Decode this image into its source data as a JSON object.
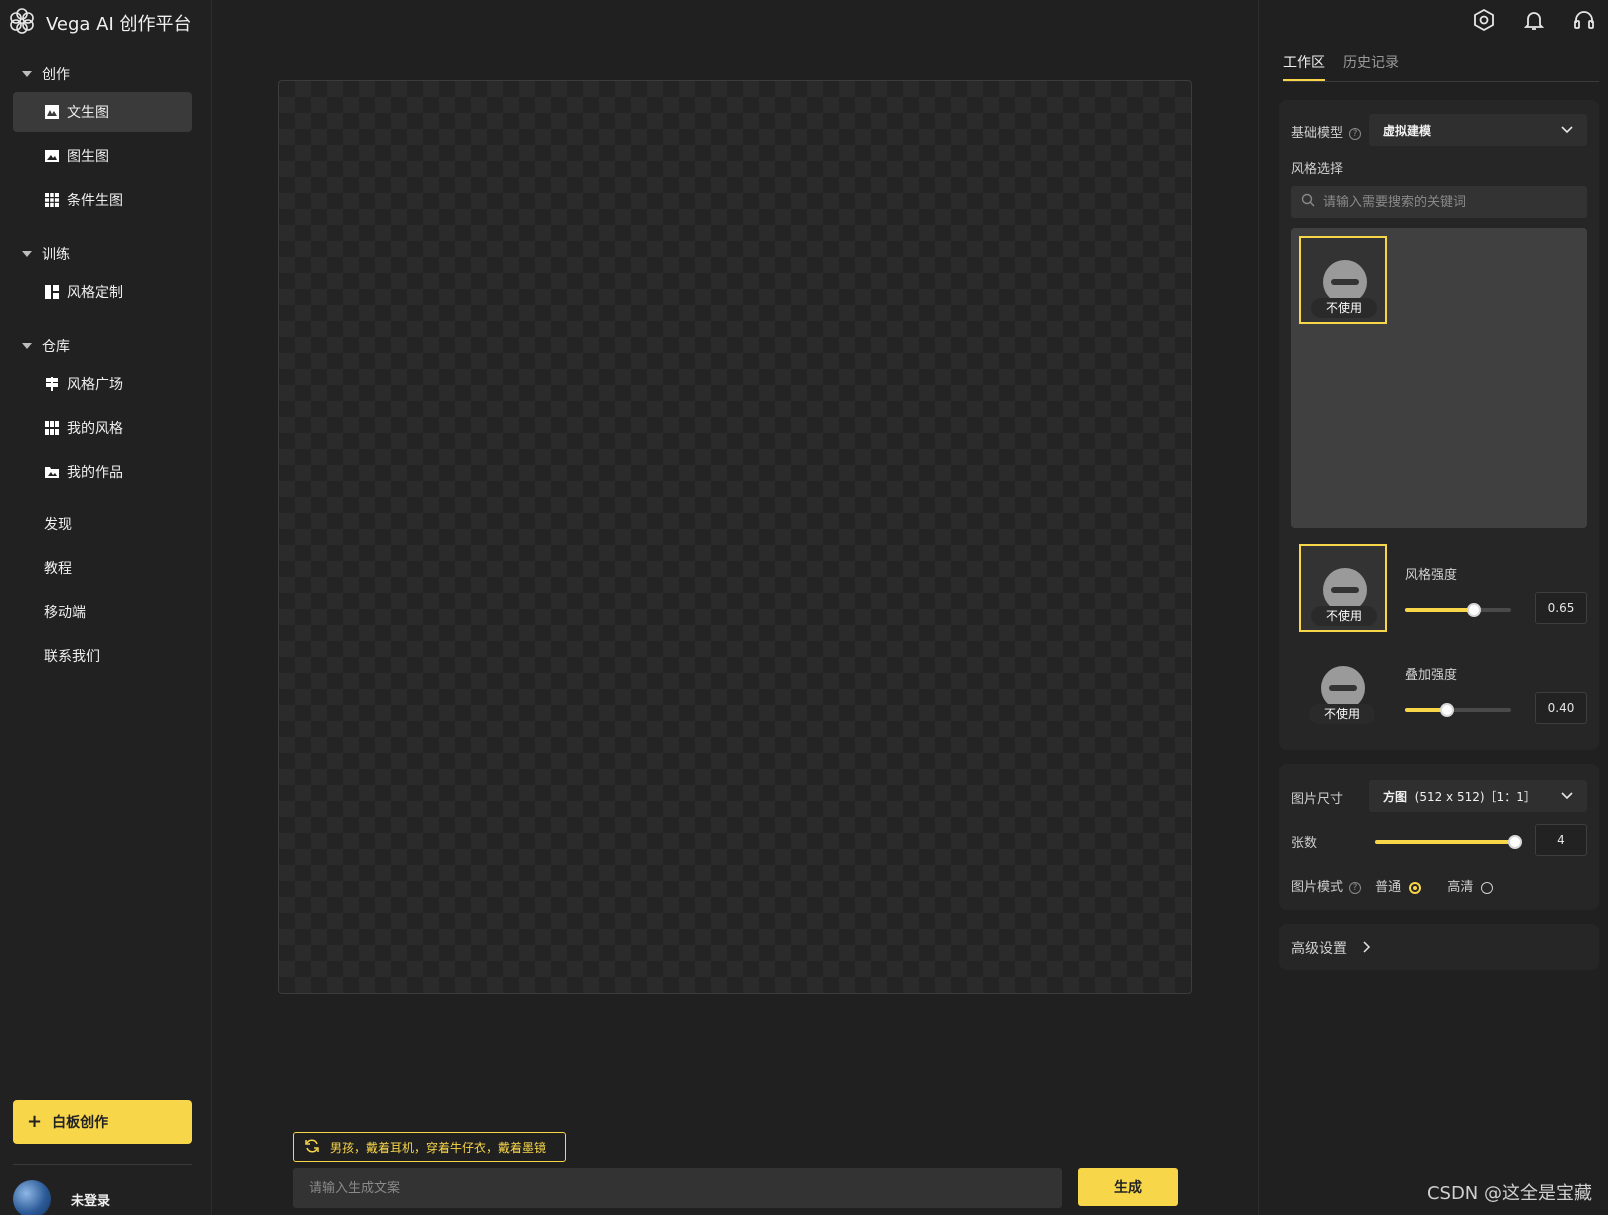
{
  "app": {
    "title": "Vega AI 创作平台"
  },
  "sidebar": {
    "groups": [
      {
        "label": "创作",
        "items": [
          {
            "label": "文生图"
          },
          {
            "label": "图生图"
          },
          {
            "label": "条件生图"
          }
        ]
      },
      {
        "label": "训练",
        "items": [
          {
            "label": "风格定制"
          }
        ]
      },
      {
        "label": "仓库",
        "items": [
          {
            "label": "风格广场"
          },
          {
            "label": "我的风格"
          },
          {
            "label": "我的作品"
          }
        ]
      }
    ],
    "links": [
      {
        "label": "发现"
      },
      {
        "label": "教程"
      },
      {
        "label": "移动端"
      },
      {
        "label": "联系我们"
      }
    ],
    "whiteboard_label": "白板创作",
    "user_name": "未登录"
  },
  "main": {
    "suggestion": "男孩，戴着耳机，穿着牛仔衣，戴着墨镜",
    "prompt_placeholder": "请输入生成文案",
    "generate_label": "生成"
  },
  "right_panel": {
    "tabs": [
      {
        "label": "工作区"
      },
      {
        "label": "历史记录"
      }
    ],
    "model_label": "基础模型",
    "model_value": "虚拟建模",
    "style_label": "风格选择",
    "search_placeholder": "请输入需要搜索的关键词",
    "tile_label": "不使用",
    "style_strength_label": "风格强度",
    "style_strength_value": "0.65",
    "stack_strength_label": "叠加强度",
    "stack_strength_value": "0.40",
    "size_label": "图片尺寸",
    "size_value_bold": "方图",
    "size_value_detail": "(512 x 512)［1：1］",
    "count_label": "张数",
    "count_value": "4",
    "mode_label": "图片模式",
    "mode_options": [
      {
        "label": "普通",
        "selected": true
      },
      {
        "label": "高清",
        "selected": false
      }
    ],
    "advanced_label": "高级设置"
  },
  "watermark": "CSDN @这全是宝藏",
  "colors": {
    "accent": "#f8d64a",
    "background": "#202020"
  },
  "slider_levels": {
    "style_strength": 0.65,
    "stack_strength": 0.4,
    "count_fraction": 1.0
  }
}
